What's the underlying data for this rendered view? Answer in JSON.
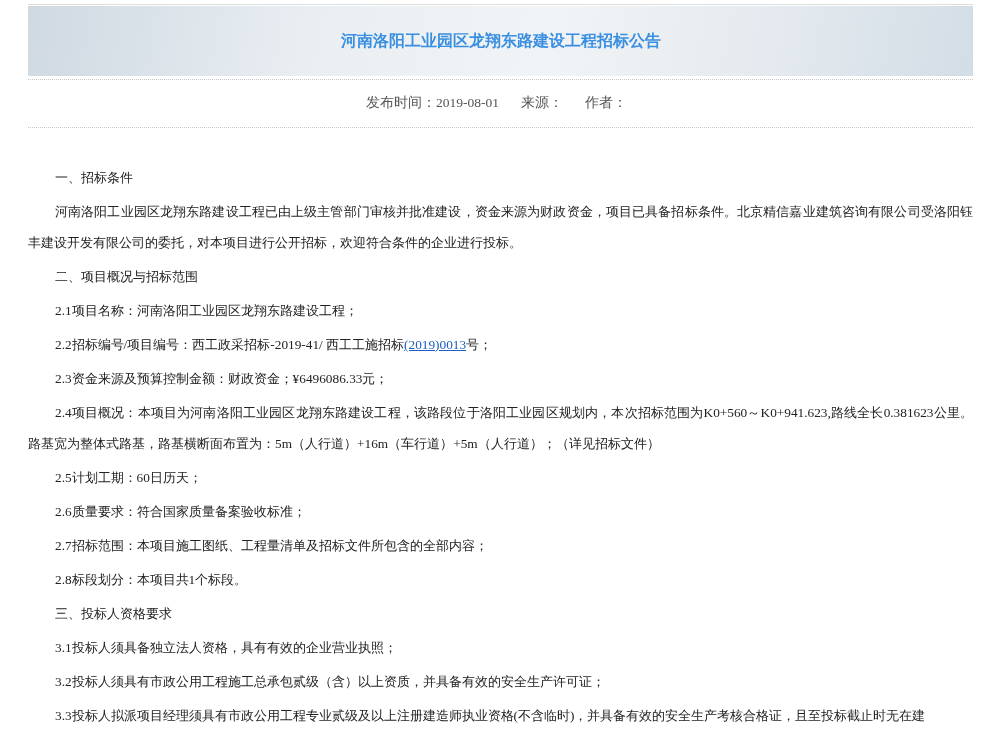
{
  "article": {
    "title": "河南洛阳工业园区龙翔东路建设工程招标公告",
    "meta": [
      "发布时间：2019-08-01",
      "来源：",
      "作者："
    ],
    "paragraphs": [
      {
        "text": "一、招标条件"
      },
      {
        "text": "河南洛阳工业园区龙翔东路建设工程已由上级主管部门审核并批准建设，资金来源为财政资金，项目已具备招标条件。北京精信嘉业建筑咨询有限公司受洛阳钰丰建设开发有限公司的委托，对本项目进行公开招标，欢迎符合条件的企业进行投标。"
      },
      {
        "text": "二、项目概况与招标范围"
      },
      {
        "text": "2.1项目名称：河南洛阳工业园区龙翔东路建设工程；"
      },
      {
        "parts": [
          {
            "text": "2.2招标编号/项目编号：西工政采招标-2019-41/ 西工工施招标",
            "link": false
          },
          {
            "text": "(2019)0013",
            "link": true
          },
          {
            "text": "号；",
            "link": false
          }
        ]
      },
      {
        "text": "2.3资金来源及预算控制金额：财政资金；¥6496086.33元；"
      },
      {
        "text": "2.4项目概况：本项目为河南洛阳工业园区龙翔东路建设工程，该路段位于洛阳工业园区规划内，本次招标范围为K0+560～K0+941.623,路线全长0.381623公里。路基宽为整体式路基，路基横断面布置为：5m（人行道）+16m（车行道）+5m（人行道）；（详见招标文件）"
      },
      {
        "text": "2.5计划工期：60日历天；"
      },
      {
        "text": "2.6质量要求：符合国家质量备案验收标准；"
      },
      {
        "text": "2.7招标范围：本项目施工图纸、工程量清单及招标文件所包含的全部内容；"
      },
      {
        "text": "2.8标段划分：本项目共1个标段。"
      },
      {
        "text": "三、投标人资格要求"
      },
      {
        "text": "3.1投标人须具备独立法人资格，具有有效的企业营业执照；"
      },
      {
        "text": "3.2投标人须具有市政公用工程施工总承包贰级（含）以上资质，并具备有效的安全生产许可证；"
      },
      {
        "text": "3.3投标人拟派项目经理须具有市政公用工程专业贰级及以上注册建造师执业资格(不含临时)，并具备有效的安全生产考核合格证，且至投标截止时无在建"
      }
    ]
  }
}
